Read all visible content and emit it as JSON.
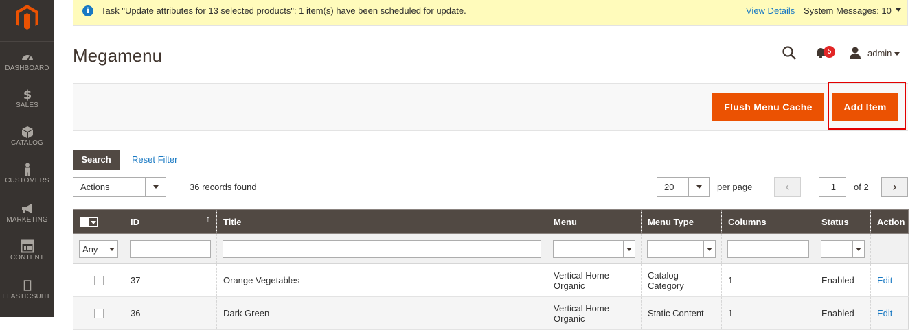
{
  "sidebar": {
    "logo": "magento-logo",
    "items": [
      {
        "label": "DASHBOARD",
        "icon": "dashboard-icon"
      },
      {
        "label": "SALES",
        "icon": "dollar-icon"
      },
      {
        "label": "CATALOG",
        "icon": "box-icon"
      },
      {
        "label": "CUSTOMERS",
        "icon": "person-icon"
      },
      {
        "label": "MARKETING",
        "icon": "megaphone-icon"
      },
      {
        "label": "CONTENT",
        "icon": "layout-icon"
      },
      {
        "label": "ELASTICSUITE",
        "icon": "elasticsuite-icon"
      }
    ]
  },
  "system_message": {
    "text": "Task \"Update attributes for 13 selected products\": 1 item(s) have been scheduled for update.",
    "details_link": "View Details",
    "system_messages": "System Messages: 10"
  },
  "header": {
    "title": "Megamenu",
    "notifications_count": "5",
    "user": "admin"
  },
  "toolbar": {
    "flush_label": "Flush Menu Cache",
    "add_label": "Add Item"
  },
  "filters": {
    "search_label": "Search",
    "reset_label": "Reset Filter",
    "actions_value": "Actions",
    "records_found": "36 records found",
    "per_page_value": "20",
    "per_page_label": "per page",
    "current_page": "1",
    "of_pages": "of 2"
  },
  "grid": {
    "headers": [
      "ID",
      "Title",
      "Menu",
      "Menu Type",
      "Columns",
      "Status",
      "Action"
    ],
    "mass_filter": "Any",
    "rows": [
      {
        "id": "37",
        "title": "Orange Vegetables",
        "menu": "Vertical Home Organic",
        "menu_type": "Catalog Category",
        "columns": "1",
        "status": "Enabled",
        "action": "Edit"
      },
      {
        "id": "36",
        "title": "Dark Green",
        "menu": "Vertical Home Organic",
        "menu_type": "Static Content",
        "columns": "1",
        "status": "Enabled",
        "action": "Edit"
      }
    ]
  },
  "colors": {
    "sidebar_bg": "#373330",
    "accent_orange": "#eb5202",
    "header_bg": "#514943",
    "link_blue": "#1979c3",
    "notice_bg": "#fffbbb",
    "highlight_red": "#e30000"
  }
}
